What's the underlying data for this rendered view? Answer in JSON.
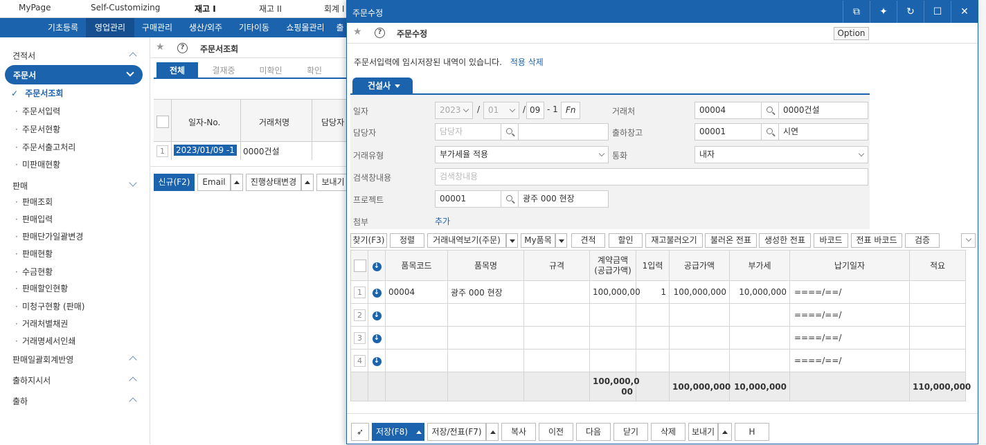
{
  "topnav": {
    "items": [
      "MyPage",
      "Self-Customizing",
      "재고 I",
      "재고 II",
      "회계 I"
    ]
  },
  "menubar": {
    "items": [
      "기초등록",
      "영업관리",
      "구매관리",
      "생산/외주",
      "기타이동",
      "쇼핑몰관리",
      "출"
    ]
  },
  "sidebar": {
    "sections": [
      {
        "label": "견적서"
      },
      {
        "label": "주문서"
      },
      {
        "label": "판매"
      },
      {
        "label": "판매일괄회계반영"
      },
      {
        "label": "출하지시서"
      },
      {
        "label": "출하"
      }
    ],
    "order_items": [
      "주문서조회",
      "주문서입력",
      "주문서현황",
      "주문서출고처리",
      "미판매현황"
    ],
    "sales_items": [
      "판매조회",
      "판매입력",
      "판매단가일괄변경",
      "판매현황",
      "수금현황",
      "판매할인현황",
      "미청구현황 (판매)",
      "거래처별채권",
      "거래명세서인쇄"
    ]
  },
  "background": {
    "title": "주문서조회",
    "tabs": [
      "전체",
      "결재중",
      "미확인",
      "확인"
    ],
    "grid_headers": [
      "일자-No.",
      "거래처명",
      "담당자"
    ],
    "grid_row": {
      "num": "1",
      "date": "2023/01/09 -1",
      "customer": "0000건설"
    },
    "buttons": [
      "신규(F2)",
      "Email",
      "진행상태변경",
      "보내기"
    ]
  },
  "dialog": {
    "title": "주문수정",
    "subtitle": "주문수정",
    "option_label": "Option",
    "notice": "주문서입력에 임시저장된 내역이 있습니다.",
    "notice_link": "적용 삭제",
    "company_tab": "건설사",
    "form": {
      "date_label": "일자",
      "date_year": "2023",
      "date_month": "01",
      "date_day": "09",
      "date_seq": "- 1",
      "fn_label": "Fn",
      "customer_label": "거래처",
      "customer_code": "00004",
      "customer_name": "0000건설",
      "manager_label": "담당자",
      "manager_placeholder": "담당자",
      "warehouse_label": "출하창고",
      "warehouse_code": "00001",
      "warehouse_name": "시연",
      "trade_type_label": "거래유형",
      "trade_type_value": "부가세율 적용",
      "currency_label": "통화",
      "currency_value": "내자",
      "search_label": "검색창내용",
      "search_placeholder": "검색창내용",
      "project_label": "프로젝트",
      "project_code": "00001",
      "project_name": "광주 000 현장",
      "attach_label": "첨부",
      "attach_link": "추가"
    },
    "toolbar": [
      "찾기(F3)",
      "정렬",
      "거래내역보기(주문)",
      "My품목",
      "견적",
      "할인",
      "재고불러오기",
      "불러온 전표",
      "생성한 전표",
      "바코드",
      "전표 바코드",
      "검증"
    ],
    "grid": {
      "headers": [
        "품목코드",
        "품목명",
        "규격",
        "계약금액\n(공급가액)",
        "1입력",
        "공급가액",
        "부가세",
        "납기일자",
        "적요"
      ],
      "rows": [
        {
          "num": "1",
          "code": "00004",
          "name": "광주 000 현장",
          "spec": "",
          "contract": "100,000,00",
          "qty": "1",
          "supply": "100,000,000",
          "vat": "10,000,000",
          "due": "====/==/",
          "memo": ""
        },
        {
          "num": "2",
          "code": "",
          "name": "",
          "spec": "",
          "contract": "",
          "qty": "",
          "supply": "",
          "vat": "",
          "due": "====/==/",
          "memo": ""
        },
        {
          "num": "3",
          "code": "",
          "name": "",
          "spec": "",
          "contract": "",
          "qty": "",
          "supply": "",
          "vat": "",
          "due": "====/==/",
          "memo": ""
        },
        {
          "num": "4",
          "code": "",
          "name": "",
          "spec": "",
          "contract": "",
          "qty": "",
          "supply": "",
          "vat": "",
          "due": "====/==/",
          "memo": ""
        }
      ],
      "totals": {
        "contract": "100,000,0\n00",
        "supply": "100,000,000",
        "vat": "10,000,000",
        "memo": "110,000,000"
      }
    },
    "bottom": [
      "저장(F8)",
      "저장/전표(F7)",
      "복사",
      "이전",
      "다음",
      "닫기",
      "삭제",
      "보내기",
      "H"
    ]
  }
}
